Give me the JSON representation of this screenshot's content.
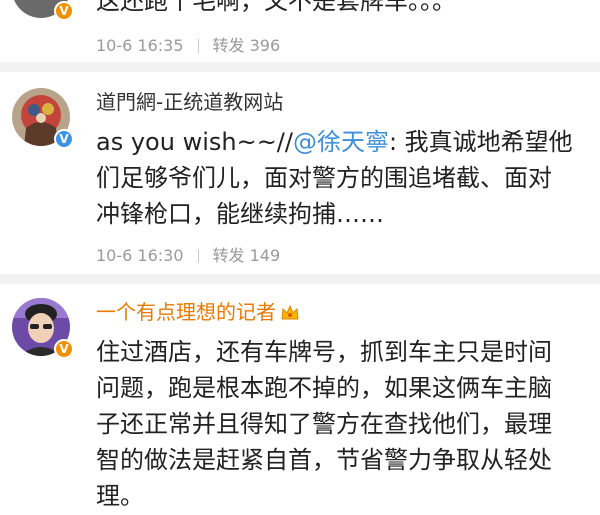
{
  "comments": [
    {
      "text_lines": [
        "这还跑个毛啊，又不是套牌车。。。"
      ],
      "date": "10-6 16:35",
      "repost_label": "转发",
      "repost_count": "396"
    },
    {
      "username": "道門網-正统道教网站",
      "text_prefix": "as you wish~~//",
      "mention": "@徐天寧",
      "text_line1_rest": ": 我真诚地希望他",
      "text_lines_rest": [
        "们足够爷们儿，面对警方的围追堵截、面对",
        "冲锋枪口，能继续拘捕……"
      ],
      "date": "10-6 16:30",
      "repost_label": "转发",
      "repost_count": "149"
    },
    {
      "username": "一个有点理想的记者",
      "text_lines": [
        "住过酒店，还有车牌号，抓到车主只是时间",
        "问题，跑是根本跑不掉的，如果这俩车主脑",
        "子还正常并且得知了警方在查找他们，最理",
        "智的做法是赶紧自首，节省警力争取从轻处",
        "理。"
      ]
    }
  ],
  "icons": {
    "verified": "verified-badge-icon",
    "vip_crown": "vip-crown-icon"
  },
  "colors": {
    "mention": "#3f8fd8",
    "vip_name": "#e87a00",
    "verified_blue": "#3b93e6",
    "verified_orange": "#f29000",
    "meta": "#9a9a9a"
  }
}
